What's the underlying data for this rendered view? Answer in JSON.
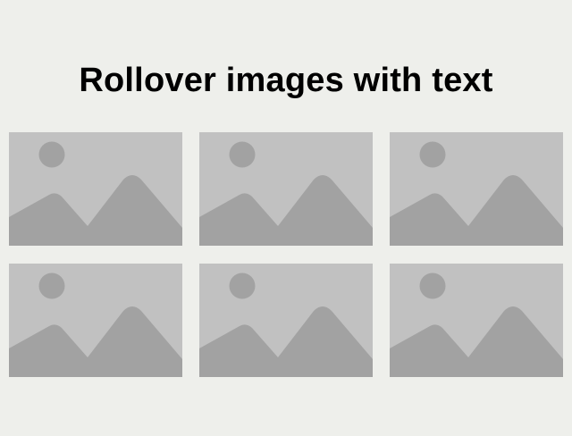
{
  "page": {
    "title": "Rollover images with text"
  },
  "colors": {
    "background": "#eeefeb",
    "placeholder_bg": "#c1c1c1",
    "placeholder_fg": "#a2a2a2",
    "title": "#000000"
  },
  "gallery": {
    "items": [
      {
        "icon": "image-placeholder-icon"
      },
      {
        "icon": "image-placeholder-icon"
      },
      {
        "icon": "image-placeholder-icon"
      },
      {
        "icon": "image-placeholder-icon"
      },
      {
        "icon": "image-placeholder-icon"
      },
      {
        "icon": "image-placeholder-icon"
      }
    ]
  }
}
